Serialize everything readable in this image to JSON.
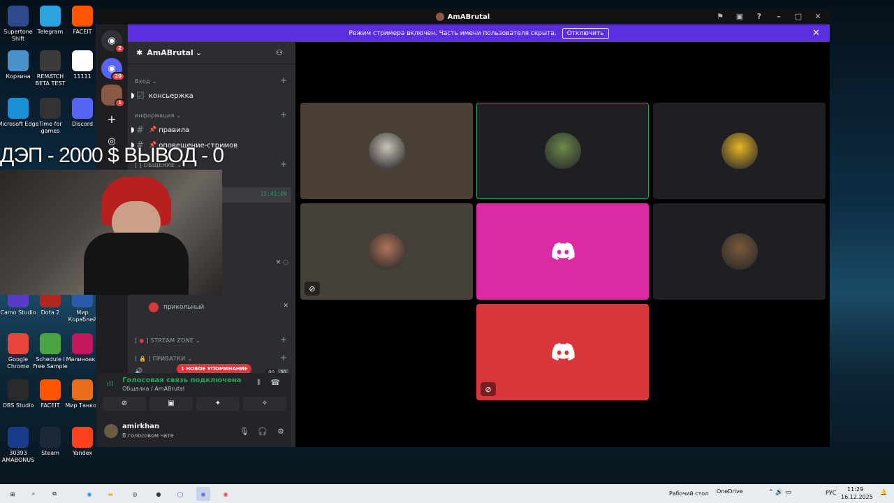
{
  "desktop": {
    "icons": [
      {
        "label": "Supertone Shift",
        "icon": "supertone-icon",
        "color": "#2d4a8a"
      },
      {
        "label": "Telegram",
        "icon": "telegram-icon",
        "color": "#2aa3df"
      },
      {
        "label": "FACEIT",
        "icon": "faceit-icon",
        "color": "#ff5500"
      },
      {
        "label": "Корзина",
        "icon": "recycle-bin-icon",
        "color": "#4a90c9"
      },
      {
        "label": "REMATCH BETA TEST",
        "icon": "rematch-icon",
        "color": "#3b3b3b"
      },
      {
        "label": "11111",
        "icon": "file-icon",
        "color": "#ffffff"
      },
      {
        "label": "Microsoft Edge",
        "icon": "edge-icon",
        "color": "#1b8fd6"
      },
      {
        "label": "Time for games",
        "icon": "gamepad-icon",
        "color": "#333333"
      },
      {
        "label": "Discord",
        "icon": "discord-icon",
        "color": "#5865f2"
      },
      {
        "label": "Camo Studio",
        "icon": "camo-icon",
        "color": "#5a3bc9"
      },
      {
        "label": "Dota 2",
        "icon": "dota-icon",
        "color": "#b3261e"
      },
      {
        "label": "Мир Кораблей",
        "icon": "ships-icon",
        "color": "#2b5aa8"
      },
      {
        "label": "Google Chrome",
        "icon": "chrome-icon",
        "color": "#e8453c"
      },
      {
        "label": "Schedule I Free Sample",
        "icon": "schedule-icon",
        "color": "#49a341"
      },
      {
        "label": "Малиновка",
        "icon": "malinovka-icon",
        "color": "#c2185b"
      },
      {
        "label": "OBS Studio",
        "icon": "obs-icon",
        "color": "#2a2a2a"
      },
      {
        "label": "FACEIT",
        "icon": "faceit-icon",
        "color": "#ff5500"
      },
      {
        "label": "Мир Танков",
        "icon": "tanks-icon",
        "color": "#e86c1a"
      },
      {
        "label": "30393 AMABONUS",
        "icon": "amabonus-icon",
        "color": "#1a3b8a"
      },
      {
        "label": "Steam",
        "icon": "steam-icon",
        "color": "#1b2838"
      },
      {
        "label": "Yandex",
        "icon": "yandex-icon",
        "color": "#fc3f1d"
      }
    ]
  },
  "stream_overlay": {
    "text": "ДЭП - 2000 $ ВЫВОД - 0"
  },
  "discord": {
    "window_title": "AmABrutal",
    "banner": {
      "text": "Режим стримера включен. Часть имени пользователя скрыта.",
      "button": "Отключить"
    },
    "guild_badges": [
      "2",
      "20",
      "1"
    ],
    "server_name": "AmABrutal",
    "categories": [
      {
        "name": "Вход",
        "channels": [
          "консьержка"
        ]
      },
      {
        "name": "информация",
        "channels": [
          "правила",
          "оповещение-стримов"
        ]
      },
      {
        "name": "[ ] ОБЩЕНИЕ",
        "channels": []
      }
    ],
    "voice_time": "11:41:09",
    "voice_member": "прикольный",
    "stream_zone": "STREAM ZONE",
    "privates": "ПРИВАТКИ",
    "mention_pill": "1 НОВОЕ УПОМИНАНИЕ",
    "voice_counts": [
      "00",
      "30"
    ],
    "voice_status": {
      "title": "Голосовая связь подключена",
      "subtitle": "Общалка / AmABrutal"
    },
    "user": {
      "name": "amirkhan",
      "status": "В голосовом чате"
    },
    "accent": "#5865f2",
    "tiles": [
      {
        "kind": "avatar",
        "bg": "#4a4036",
        "avatar_color": "#c9c3b8"
      },
      {
        "kind": "avatar",
        "bg": "#1e1f22",
        "avatar_color": "#6b8a4b",
        "speaking": true
      },
      {
        "kind": "avatar",
        "bg": "#1e1f22",
        "avatar_color": "#e8b623"
      },
      {
        "kind": "avatar",
        "bg": "#46403a",
        "avatar_color": "#b0745a",
        "muted": true
      },
      {
        "kind": "logo",
        "bg": "#dc2aa2"
      },
      {
        "kind": "avatar",
        "bg": "#1e1f22",
        "avatar_color": "#7a5a3a"
      },
      {
        "kind": "logo",
        "bg": "#da373c",
        "muted": true
      }
    ]
  },
  "taskbar": {
    "desktop_label": "Рабочий стол",
    "onedrive": "OneDrive",
    "lang": "РУС",
    "time": "11:29",
    "date": "16.12.2025"
  }
}
